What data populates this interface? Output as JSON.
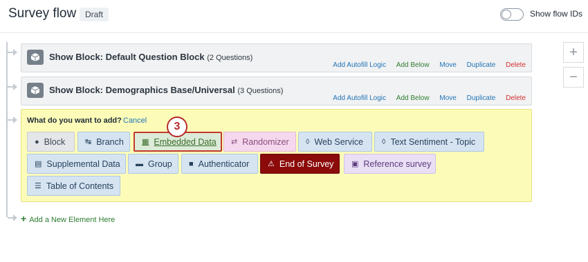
{
  "header": {
    "title": "Survey flow",
    "status_badge": "Draft",
    "toggle_label": "Show flow IDs"
  },
  "blocks": [
    {
      "title": "Show Block: Default Question Block",
      "count": "(2 Questions)"
    },
    {
      "title": "Show Block: Demographics Base/Universal",
      "count": "(3 Questions)"
    }
  ],
  "block_actions": {
    "autofill": "Add Autofill Logic",
    "add_below": "Add Below",
    "move": "Move",
    "duplicate": "Duplicate",
    "delete": "Delete"
  },
  "add_panel": {
    "question": "What do you want to add?",
    "cancel": "Cancel",
    "badge": "3",
    "options": [
      {
        "label": "Block",
        "icon": "cube-icon"
      },
      {
        "label": "Branch",
        "icon": "branch-icon"
      },
      {
        "label": "Embedded Data",
        "icon": "embedded-data-icon"
      },
      {
        "label": "Randomizer",
        "icon": "shuffle-icon"
      },
      {
        "label": "Web Service",
        "icon": "rss-icon"
      },
      {
        "label": "Text Sentiment - Topic",
        "icon": "rss-icon"
      },
      {
        "label": "Supplemental Data",
        "icon": "database-icon"
      },
      {
        "label": "Group",
        "icon": "folder-icon"
      },
      {
        "label": "Authenticator",
        "icon": "lock-icon"
      },
      {
        "label": "End of Survey",
        "icon": "warning-icon"
      },
      {
        "label": "Reference survey",
        "icon": "clipboard-icon"
      },
      {
        "label": "Table of Contents",
        "icon": "list-icon"
      }
    ]
  },
  "add_new": "Add a New Element Here",
  "zoom": {
    "in": "+",
    "out": "−"
  }
}
